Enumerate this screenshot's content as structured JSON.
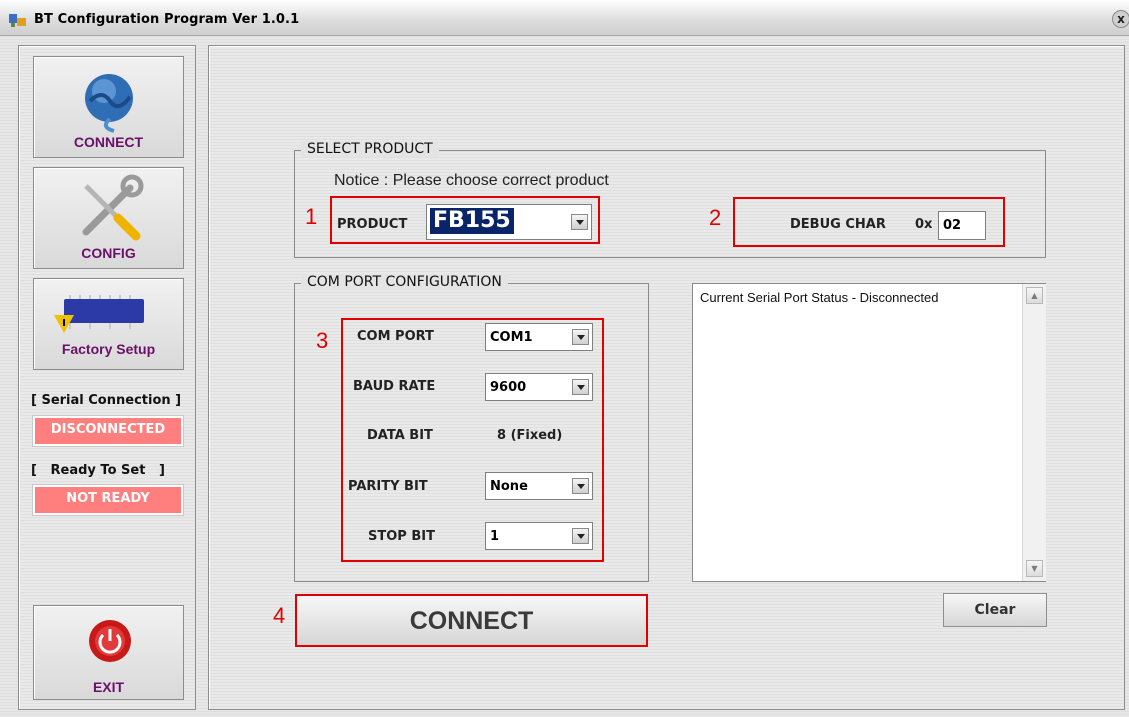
{
  "window": {
    "title": "BT Configuration Program Ver 1.0.1",
    "close_glyph": "x"
  },
  "sidebar": {
    "connect_label": "CONNECT",
    "config_label": "CONFIG",
    "factory_label": "Factory Setup",
    "exit_label": "EXIT",
    "serial_heading": "[ Serial Connection ]",
    "serial_status": "DISCONNECTED",
    "ready_heading": "[   Ready To Set   ]",
    "ready_status": "NOT READY",
    "status_color": "#ff7f7f"
  },
  "select_product": {
    "title": "SELECT PRODUCT",
    "notice": "Notice : Please choose correct product",
    "product_label": "PRODUCT",
    "product_value": "FB155",
    "debug_label": "DEBUG CHAR",
    "debug_prefix": "0x",
    "debug_value": "02"
  },
  "com_config": {
    "title": "COM PORT CONFIGURATION",
    "com_port_label": "COM PORT",
    "com_port_value": "COM1",
    "baud_rate_label": "BAUD RATE",
    "baud_rate_value": "9600",
    "data_bit_label": "DATA BIT",
    "data_bit_value": "8 (Fixed)",
    "parity_label": "PARITY BIT",
    "parity_value": "None",
    "stop_bit_label": "STOP BIT",
    "stop_bit_value": "1"
  },
  "log": {
    "text": "Current Serial Port Status - Disconnected"
  },
  "buttons": {
    "connect": "CONNECT",
    "clear": "Clear"
  },
  "annotations": {
    "n1": "1",
    "n2": "2",
    "n3": "3",
    "n4": "4",
    "color": "#e00000"
  }
}
